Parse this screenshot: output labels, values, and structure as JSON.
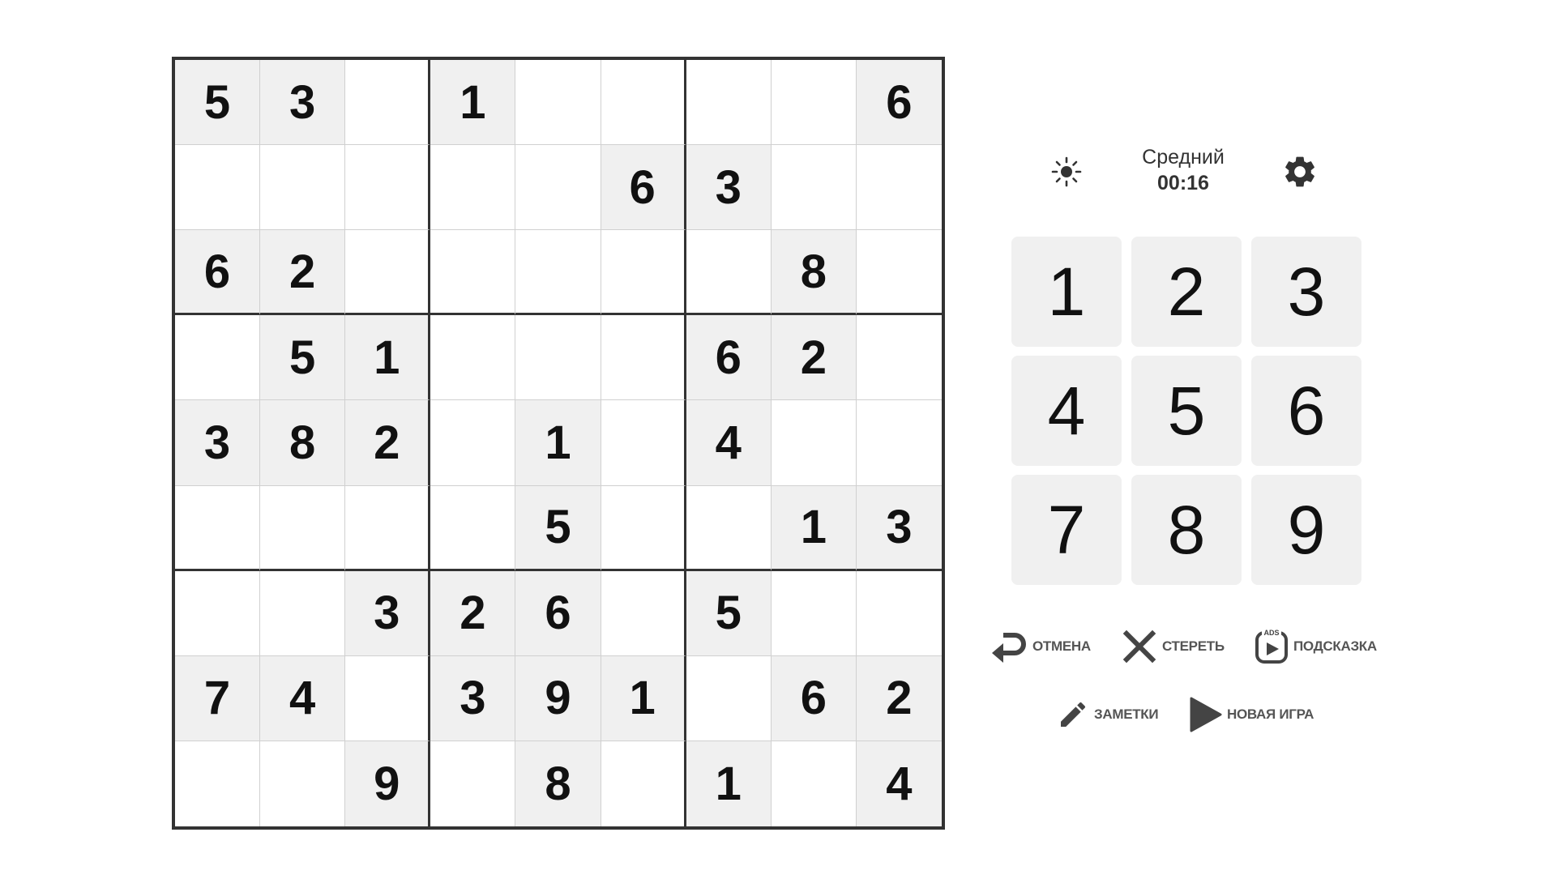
{
  "board": {
    "cells": [
      [
        "5",
        "3",
        "",
        "1",
        "",
        "",
        "",
        "",
        "6"
      ],
      [
        "",
        "",
        "",
        "",
        "",
        "6",
        "3",
        "",
        ""
      ],
      [
        "6",
        "2",
        "",
        "",
        "",
        "",
        "",
        "8",
        ""
      ],
      [
        "",
        "5",
        "1",
        "",
        "",
        "",
        "6",
        "2",
        ""
      ],
      [
        "3",
        "8",
        "2",
        "",
        "1",
        "",
        "4",
        "",
        ""
      ],
      [
        "",
        "",
        "",
        "",
        "5",
        "",
        "",
        "1",
        "3"
      ],
      [
        "",
        "",
        "3",
        "2",
        "6",
        "",
        "5",
        "",
        ""
      ],
      [
        "7",
        "4",
        "",
        "3",
        "9",
        "1",
        "",
        "6",
        "2"
      ],
      [
        "",
        "",
        "9",
        "",
        "8",
        "",
        "1",
        "",
        "4"
      ]
    ],
    "given": [
      [
        1,
        1,
        0,
        1,
        0,
        0,
        0,
        0,
        1
      ],
      [
        0,
        0,
        0,
        0,
        0,
        1,
        1,
        0,
        0
      ],
      [
        1,
        1,
        0,
        0,
        0,
        0,
        0,
        1,
        0
      ],
      [
        0,
        1,
        1,
        0,
        0,
        0,
        1,
        1,
        0
      ],
      [
        1,
        1,
        1,
        0,
        1,
        0,
        1,
        0,
        0
      ],
      [
        0,
        0,
        0,
        0,
        1,
        0,
        0,
        1,
        1
      ],
      [
        0,
        0,
        1,
        1,
        1,
        0,
        1,
        0,
        0
      ],
      [
        1,
        1,
        0,
        1,
        1,
        1,
        0,
        1,
        1
      ],
      [
        0,
        0,
        1,
        0,
        1,
        0,
        1,
        0,
        1
      ]
    ]
  },
  "header": {
    "difficulty": "Средний",
    "timer": "00:16",
    "theme_icon": "sun-icon",
    "settings_icon": "gear-icon"
  },
  "numpad": {
    "keys": [
      "1",
      "2",
      "3",
      "4",
      "5",
      "6",
      "7",
      "8",
      "9"
    ]
  },
  "actions": {
    "undo": {
      "label": "ОТМЕНА",
      "icon": "undo-arrow-icon"
    },
    "erase": {
      "label": "СТЕРЕТЬ",
      "icon": "x-icon"
    },
    "hint": {
      "label": "ПОДСКАЗКА",
      "icon": "video-ad-icon",
      "badge": "ADS"
    },
    "notes": {
      "label": "ЗАМЕТКИ",
      "icon": "pencil-icon"
    },
    "new_game": {
      "label": "НОВАЯ ИГРА",
      "icon": "play-icon"
    }
  },
  "colors": {
    "given_cell_bg": "#f0f0f0",
    "grid_thick": "#333333",
    "grid_thin": "#d0d0d0",
    "icon": "#444444",
    "label": "#555555"
  }
}
